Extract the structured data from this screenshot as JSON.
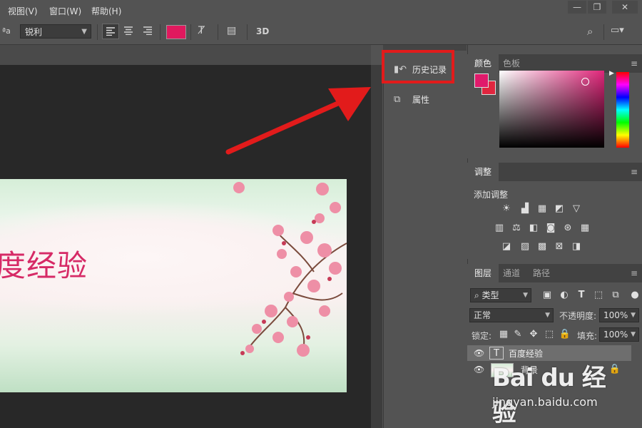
{
  "menu": {
    "items": [
      {
        "label": "视图(V)"
      },
      {
        "label": "窗口(W)"
      },
      {
        "label": "帮助(H)"
      }
    ]
  },
  "window_controls": {
    "minimize": "—",
    "restore": "❐",
    "close": "✕"
  },
  "options_bar": {
    "aa_glyph": "ªa",
    "antialias_value": "锐利",
    "text_color": "#e0195e",
    "threed_label": "3D"
  },
  "artwork": {
    "text": "度经验"
  },
  "mid_panel": {
    "history_label": "历史记录",
    "properties_label": "属性",
    "highlight_color": "#e21b1b"
  },
  "color_panel": {
    "tabs": [
      "颜色",
      "色板"
    ],
    "foreground": "#e01a6b",
    "background": "#e0263f"
  },
  "adjustments_panel": {
    "tab": "调整",
    "title": "添加调整"
  },
  "layers_panel": {
    "tabs": [
      "图层",
      "通道",
      "路径"
    ],
    "filter_kind": "类型",
    "blend_mode": "正常",
    "opacity_label": "不透明度:",
    "opacity_value": "100%",
    "lock_label": "锁定:",
    "fill_label": "填充:",
    "fill_value": "100%",
    "layers": [
      {
        "name": "百度经验",
        "type": "text",
        "selected": true
      },
      {
        "name": "背景",
        "type": "image",
        "selected": false,
        "locked": true
      }
    ]
  },
  "watermark": {
    "logo": "Bai du 经验",
    "url": "jingyan.baidu.com"
  }
}
